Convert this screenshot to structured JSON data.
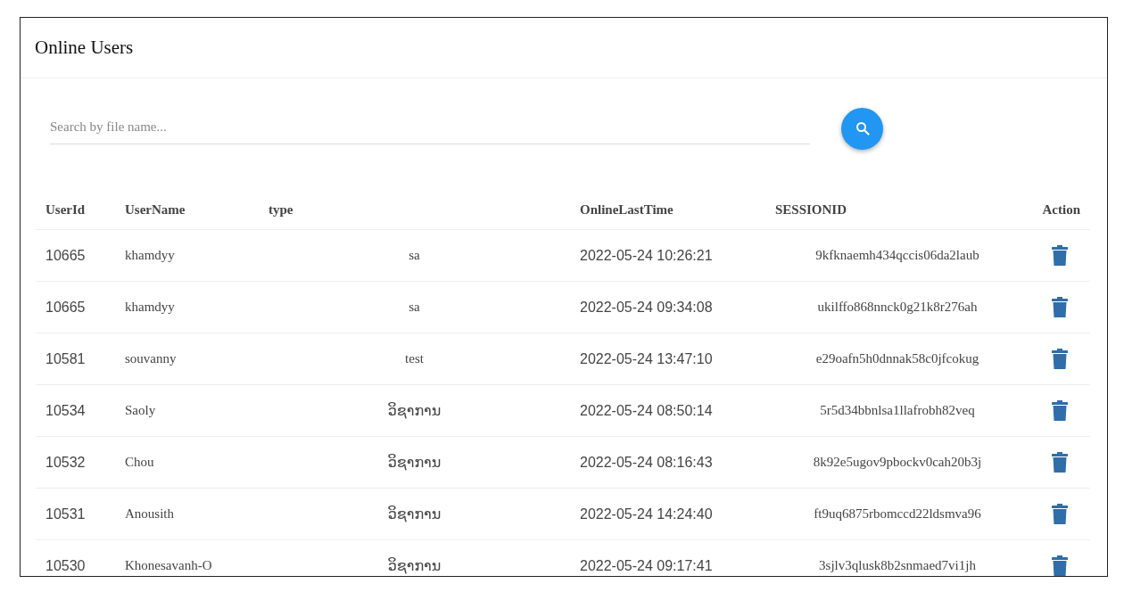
{
  "card": {
    "title": "Online Users"
  },
  "search": {
    "placeholder": "Search by file name..."
  },
  "table": {
    "columns": [
      "UserId",
      "UserName",
      "type",
      "OnlineLastTime",
      "SESSIONID",
      "Action"
    ],
    "rows": [
      {
        "user_id": "10665",
        "user_name": "khamdyy",
        "type": "sa",
        "online_last_time": "2022-05-24 10:26:21",
        "session_id": "9kfknaemh434qccis06da2laub"
      },
      {
        "user_id": "10665",
        "user_name": "khamdyy",
        "type": "sa",
        "online_last_time": "2022-05-24 09:34:08",
        "session_id": "ukilffo868nnck0g21k8r276ah"
      },
      {
        "user_id": "10581",
        "user_name": "souvanny",
        "type": "test",
        "online_last_time": "2022-05-24 13:47:10",
        "session_id": "e29oafn5h0dnnak58c0jfcokug"
      },
      {
        "user_id": "10534",
        "user_name": "Saoly",
        "type": "ວິຊາການ",
        "online_last_time": "2022-05-24 08:50:14",
        "session_id": "5r5d34bbnlsa1llafrobh82veq"
      },
      {
        "user_id": "10532",
        "user_name": "Chou",
        "type": "ວິຊາການ",
        "online_last_time": "2022-05-24 08:16:43",
        "session_id": "8k92e5ugov9pbockv0cah20b3j"
      },
      {
        "user_id": "10531",
        "user_name": "Anousith",
        "type": "ວິຊາການ",
        "online_last_time": "2022-05-24 14:24:40",
        "session_id": "ft9uq6875rbomccd22ldsmva96"
      },
      {
        "user_id": "10530",
        "user_name": "Khonesavanh-O",
        "type": "ວິຊາການ",
        "online_last_time": "2022-05-24 09:17:41",
        "session_id": "3sjlv3qlusk8b2snmaed7vi1jh"
      }
    ]
  }
}
